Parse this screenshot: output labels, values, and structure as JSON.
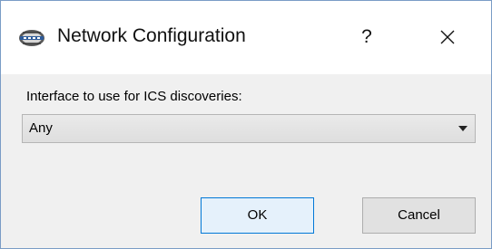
{
  "window": {
    "title": "Network Configuration",
    "help_label": "?",
    "icon": "network-app-icon",
    "close_icon": "close-icon"
  },
  "form": {
    "interface_label": "Interface to use for ICS discoveries:",
    "interface_select": {
      "selected": "Any"
    }
  },
  "buttons": {
    "ok_label": "OK",
    "cancel_label": "Cancel"
  },
  "colors": {
    "default_button_border": "#0078d7",
    "default_button_fill": "#e5f1fb",
    "client_background": "#f0f0f0"
  }
}
